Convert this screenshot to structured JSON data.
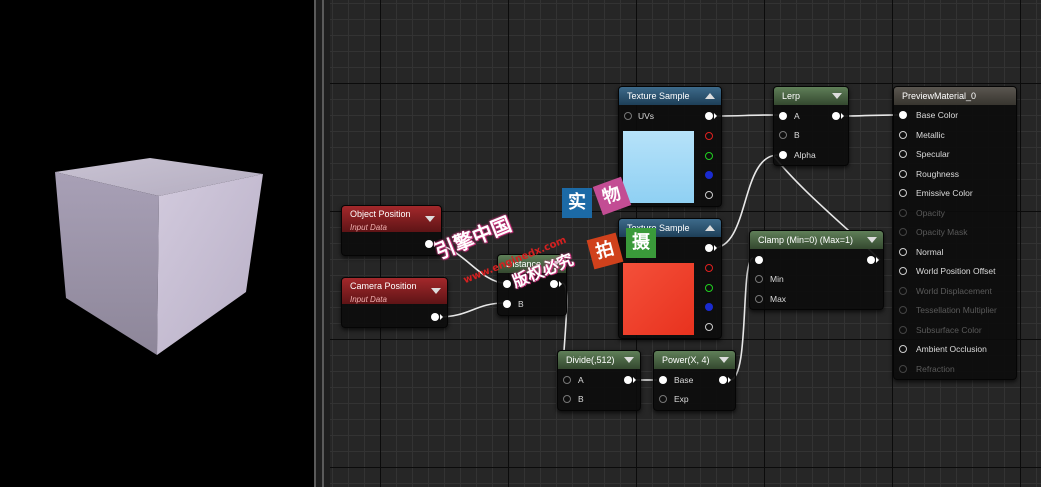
{
  "nodes": {
    "texture_sample_1": {
      "title": "Texture Sample",
      "uvs": "UVs"
    },
    "texture_sample_2": {
      "title": "Texture Sample"
    },
    "lerp": {
      "title": "Lerp",
      "a": "A",
      "b": "B",
      "alpha": "Alpha"
    },
    "object_position": {
      "title": "Object Position",
      "subtitle": "Input Data"
    },
    "camera_position": {
      "title": "Camera Position",
      "subtitle": "Input Data"
    },
    "distance": {
      "title": "Distance",
      "a": "A",
      "b": "B"
    },
    "clamp": {
      "title": "Clamp (Min=0) (Max=1)",
      "min": "Min",
      "max": "Max"
    },
    "divide": {
      "title": "Divide(,512)",
      "a": "A",
      "b": "B"
    },
    "power": {
      "title": "Power(X, 4)",
      "base": "Base",
      "exp": "Exp"
    }
  },
  "material": {
    "title": "PreviewMaterial_0",
    "inputs": [
      {
        "label": "Base Color",
        "enabled": true,
        "connected": true
      },
      {
        "label": "Metallic",
        "enabled": true
      },
      {
        "label": "Specular",
        "enabled": true
      },
      {
        "label": "Roughness",
        "enabled": true
      },
      {
        "label": "Emissive Color",
        "enabled": true
      },
      {
        "label": "Opacity",
        "enabled": false
      },
      {
        "label": "Opacity Mask",
        "enabled": false
      },
      {
        "label": "Normal",
        "enabled": true
      },
      {
        "label": "World Position Offset",
        "enabled": true
      },
      {
        "label": "World Displacement",
        "enabled": false
      },
      {
        "label": "Tessellation Multiplier",
        "enabled": false
      },
      {
        "label": "Subsurface Color",
        "enabled": false
      },
      {
        "label": "Ambient Occlusion",
        "enabled": true
      },
      {
        "label": "Refraction",
        "enabled": false
      }
    ]
  },
  "watermark": {
    "line1": "引擎中国",
    "line2": "www.enginedx.com",
    "line3": "版权必究",
    "tile1": "实",
    "tile2": "物",
    "tile3": "拍",
    "tile4": "摄"
  },
  "colors": {
    "texture1_preview": "#a9dcf6",
    "texture2_preview": "#f44530",
    "cube": "#bab1c9"
  }
}
